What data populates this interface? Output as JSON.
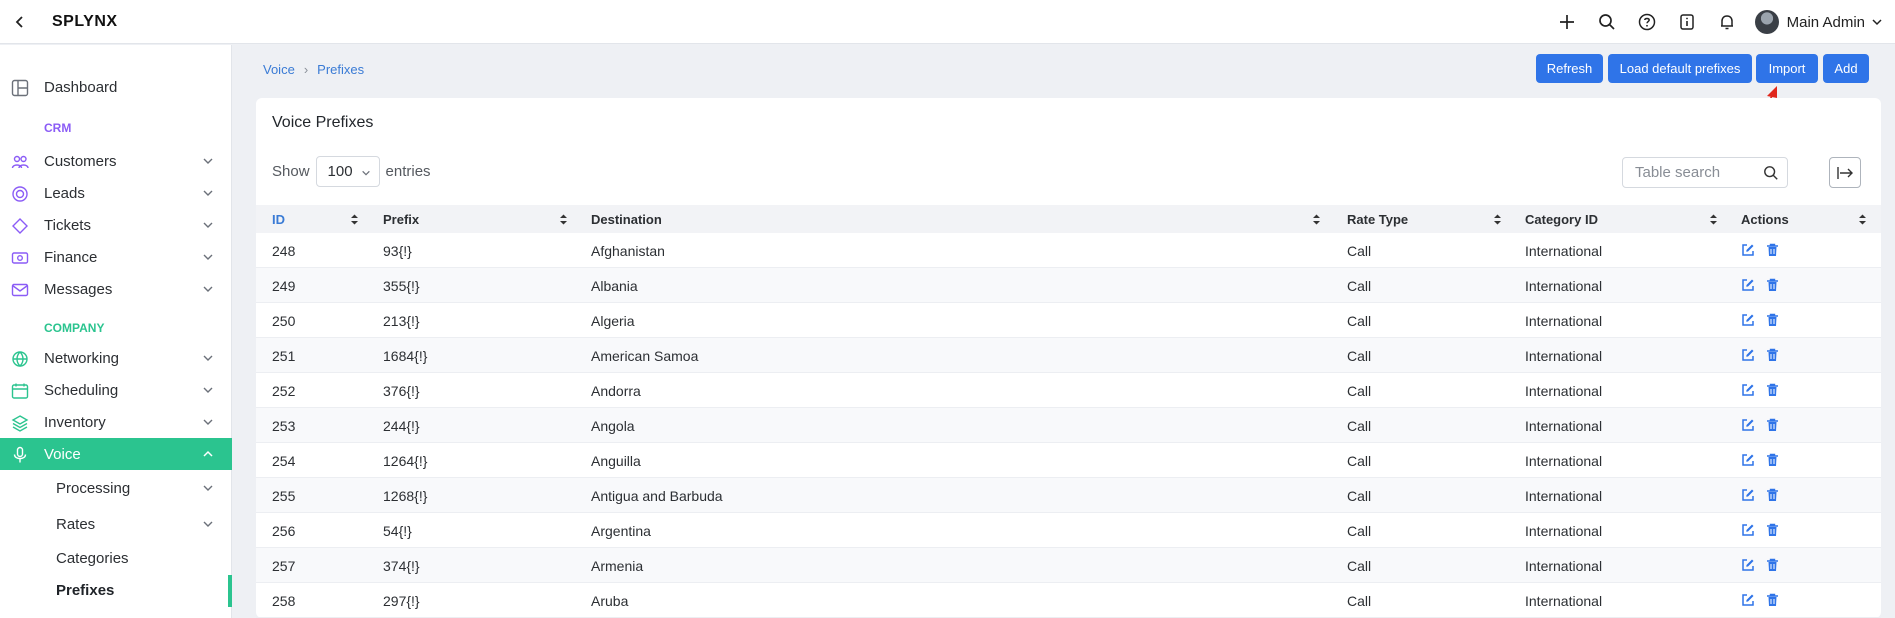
{
  "app": {
    "title": "SPLYNX",
    "user_name": "Main Admin"
  },
  "topbar": {
    "icons": [
      "back-icon",
      "plus-icon",
      "search-icon",
      "help-icon",
      "info-icon",
      "bell-icon"
    ]
  },
  "sidebar": {
    "accent_color": "#2bc48f",
    "dashboard": "Dashboard",
    "section_crm": "CRM",
    "crm_items": [
      "Customers",
      "Leads",
      "Tickets",
      "Finance",
      "Messages"
    ],
    "section_company": "COMPANY",
    "company_items": [
      "Networking",
      "Scheduling",
      "Inventory",
      "Voice"
    ],
    "voice_sub": [
      "Processing",
      "Rates",
      "Categories",
      "Prefixes"
    ]
  },
  "breadcrumb": {
    "parent": "Voice",
    "current": "Prefixes"
  },
  "actions": {
    "refresh": "Refresh",
    "load_default": "Load default prefixes",
    "import": "Import",
    "add": "Add"
  },
  "card": {
    "title": "Voice Prefixes",
    "show_label": "Show",
    "entries_value": "100",
    "entries_label": "entries",
    "search_placeholder": "Table search"
  },
  "table": {
    "columns": [
      "ID",
      "Prefix",
      "Destination",
      "Rate Type",
      "Category ID",
      "Actions"
    ],
    "rows": [
      [
        "248",
        "93{!}",
        "Afghanistan",
        "Call",
        "International"
      ],
      [
        "249",
        "355{!}",
        "Albania",
        "Call",
        "International"
      ],
      [
        "250",
        "213{!}",
        "Algeria",
        "Call",
        "International"
      ],
      [
        "251",
        "1684{!}",
        "American Samoa",
        "Call",
        "International"
      ],
      [
        "252",
        "376{!}",
        "Andorra",
        "Call",
        "International"
      ],
      [
        "253",
        "244{!}",
        "Angola",
        "Call",
        "International"
      ],
      [
        "254",
        "1264{!}",
        "Anguilla",
        "Call",
        "International"
      ],
      [
        "255",
        "1268{!}",
        "Antigua and Barbuda",
        "Call",
        "International"
      ],
      [
        "256",
        "54{!}",
        "Argentina",
        "Call",
        "International"
      ],
      [
        "257",
        "374{!}",
        "Armenia",
        "Call",
        "International"
      ],
      [
        "258",
        "297{!}",
        "Aruba",
        "Call",
        "International"
      ]
    ]
  }
}
